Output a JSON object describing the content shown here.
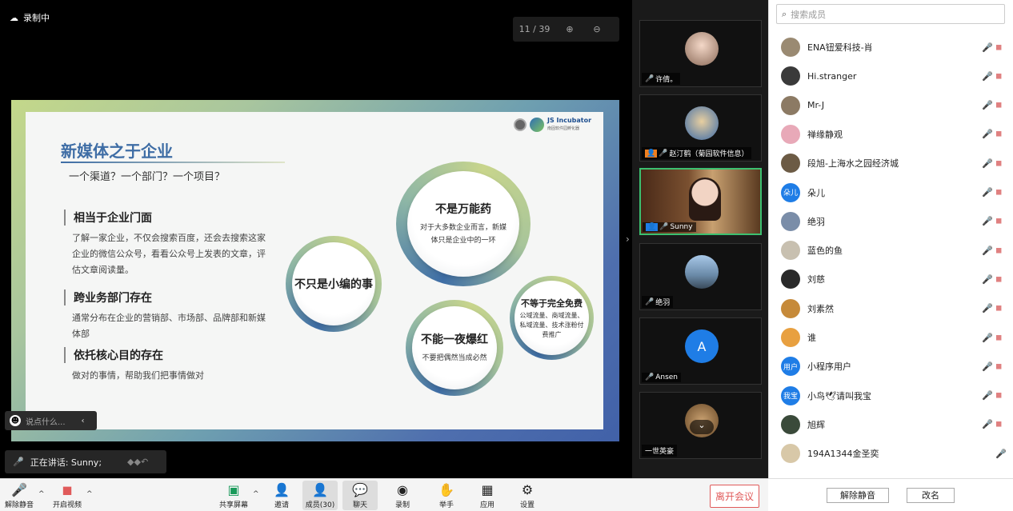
{
  "recording": {
    "label": "录制中"
  },
  "pager": {
    "text": "11 / 39"
  },
  "slide": {
    "title": "新媒体之于企业",
    "subtitle": "一个渠道？一个部门？一个项目？",
    "logo_text": "JS Incubator",
    "logo_sub": "南固软件园孵化器",
    "sections": [
      {
        "heading": "相当于企业门面",
        "body": "了解一家企业，不仅会搜索百度，还会去搜索这家企业的微信公众号，看看公众号上发表的文章，评估文章阅读量。"
      },
      {
        "heading": "跨业务部门存在",
        "body": "通常分布在企业的营销部、市场部、品牌部和新媒体部"
      },
      {
        "heading": "依托核心目的存在",
        "body": "做对的事情，帮助我们把事情做对"
      }
    ],
    "circles": {
      "top": {
        "title": "不是万能药",
        "text": "对于大多数企业而言，新媒体只是企业中的一环"
      },
      "left": {
        "title": "不只是小编的事"
      },
      "bottom": {
        "title": "不能一夜爆红",
        "text": "不要把偶然当成必然"
      },
      "right": {
        "title": "不等于完全免费",
        "text": "公域流量、商域流量、私域流量、技术涨粉付费推广"
      }
    }
  },
  "chat_hint": {
    "placeholder": "说点什么..."
  },
  "speaking": {
    "label": "正在讲话: Sunny;"
  },
  "gallery": [
    {
      "name": "许倩。"
    },
    {
      "name": "赵汀鹤（菊园软件信息）"
    },
    {
      "name": "Sunny"
    },
    {
      "name": "绝羽"
    },
    {
      "name": "Ansen",
      "initial": "A"
    },
    {
      "name": "一世英豪"
    }
  ],
  "members": {
    "search_placeholder": "搜索成员",
    "list": [
      {
        "name": "ENA钮爱科技-肖",
        "color": "#9a8a72"
      },
      {
        "name": "Hi.stranger",
        "color": "#3a3a3a"
      },
      {
        "name": "Mr-J",
        "color": "#8c7a64"
      },
      {
        "name": "禅缘静观",
        "color": "#e8a9b8"
      },
      {
        "name": "段旭-上海水之园经济城",
        "color": "#6c5b45"
      },
      {
        "name": "朵儿",
        "color": "#1f7de6",
        "avatar_text": "朵儿"
      },
      {
        "name": "绝羽",
        "color": "#7a8da8"
      },
      {
        "name": "蓝色的鱼",
        "color": "#c8c0b0"
      },
      {
        "name": "刘慈",
        "color": "#2a2a2a"
      },
      {
        "name": "刘素然",
        "color": "#c68a3a"
      },
      {
        "name": "谁",
        "color": "#e8a040"
      },
      {
        "name": "小程序用户",
        "color": "#1f7de6",
        "avatar_text": "用户"
      },
      {
        "name": "小鸟🕊请叫我宝",
        "color": "#1f7de6",
        "avatar_text": "我宝"
      },
      {
        "name": "旭辉",
        "color": "#3a4a3a"
      },
      {
        "name": "194A1344金圣奕",
        "color": "#d8c8a8"
      }
    ]
  },
  "panel_buttons": {
    "unmute_all": "解除静音",
    "rename": "改名"
  },
  "toolbar": {
    "unmute": "解除静音",
    "video": "开启视频",
    "share": "共享屏幕",
    "invite": "邀请",
    "members": "成员(30)",
    "chat": "聊天",
    "record": "录制",
    "hand": "举手",
    "apps": "应用",
    "settings": "设置",
    "leave": "离开会议"
  }
}
